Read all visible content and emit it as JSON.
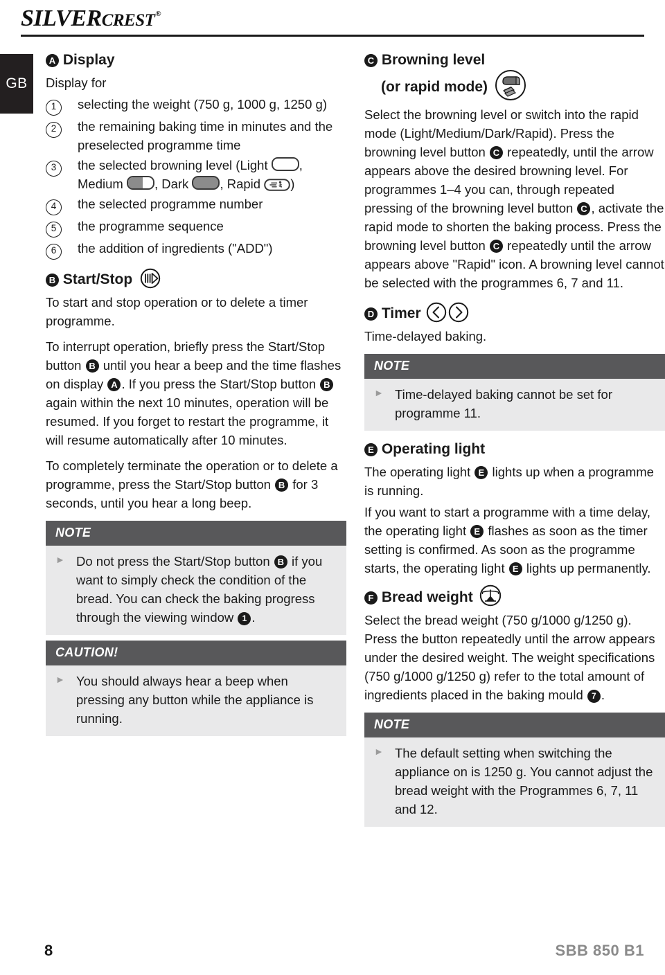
{
  "header": {
    "brand_silver": "SILVER",
    "brand_crest": "CREST",
    "brand_reg": "®"
  },
  "language_tab": {
    "label": "GB"
  },
  "left_column": {
    "section_a": {
      "marker": "A",
      "title": "Display",
      "intro": "Display for",
      "items": [
        {
          "num": "1",
          "text": "selecting the weight (750 g, 1000 g, 1250 g)"
        },
        {
          "num": "2",
          "text": "the remaining baking time in minutes and the preselected programme time"
        },
        {
          "num": "3",
          "text_before": "the selected browning level (Light ",
          "text_mid1": ", Medium ",
          "text_mid2": ", Dark ",
          "text_mid3": ", Rapid ",
          "text_after": ")"
        },
        {
          "num": "4",
          "text": "the selected programme number"
        },
        {
          "num": "5",
          "text": "the programme sequence"
        },
        {
          "num": "6",
          "text": "the addition of ingredients (\"ADD\")"
        }
      ]
    },
    "section_b": {
      "marker": "B",
      "title": "Start/Stop",
      "icon": "start-stop-icon",
      "para1": "To start and stop operation or to delete a timer programme.",
      "para2_1": "To interrupt operation, briefly press the Start/Stop button ",
      "para2_2": " until you hear a beep and the time flashes on display ",
      "para2_3": ". If you press the Start/Stop button ",
      "para2_4": " again within the next 10 minutes, operation will be resumed. If you forget to restart the programme, it will resume automatically after 10 minutes.",
      "para2_mark_b1": "B",
      "para2_mark_a": "A",
      "para2_mark_b2": "B",
      "para3_1": "To completely terminate the operation or to delete a programme, press the Start/Stop button ",
      "para3_mark": "B",
      "para3_2": " for 3 seconds, until you hear a long beep."
    },
    "note_box": {
      "head": "NOTE",
      "text_1": "Do not press the Start/Stop button ",
      "mark": "B",
      "text_2": " if you want to simply check the condition of the bread. You can check the baking progress through the viewing window ",
      "mark2": "1",
      "text_3": "."
    },
    "caution_box": {
      "head": "CAUTION!",
      "text": "You should always hear a beep when pressing any button while the appliance is running."
    }
  },
  "right_column": {
    "section_c": {
      "marker": "C",
      "title_line1": "Browning level",
      "title_line2": "(or rapid mode)",
      "icon": "bread-loaf-icon",
      "para_1": "Select the browning level or switch into the rapid mode (Light/Medium/Dark/Rapid). Press the browning level button ",
      "mark_c1": "C",
      "para_2": " repeatedly, until the arrow appears above the desired browning level. For programmes 1–4 you can, through repeated pressing of the browning level button ",
      "mark_c2": "C",
      "para_3": ", activate the rapid mode to shorten the baking process. Press the browning level button ",
      "mark_c3": "C",
      "para_4": " repeatedly until the arrow appears above \"Rapid\" icon. A browning level cannot be selected with the programmes 6, 7 and 11."
    },
    "section_d": {
      "marker": "D",
      "title": "Timer",
      "icon_left": "chevron-left-circle-icon",
      "icon_right": "chevron-right-circle-icon",
      "para": "Time-delayed baking."
    },
    "note_box_d": {
      "head": "NOTE",
      "text": "Time-delayed baking cannot be set for programme 11."
    },
    "section_e": {
      "marker": "E",
      "title": "Operating light",
      "para_1": "The operating light ",
      "mark_e1": "E",
      "para_2": " lights up when a programme is running.",
      "para_3": "If you want to start a programme with a time delay, the operating light ",
      "mark_e2": "E",
      "para_4": " flashes as soon as the timer setting is confirmed. As soon as the programme starts, the operating light ",
      "mark_e3": "E",
      "para_5": " lights up permanently."
    },
    "section_f": {
      "marker": "F",
      "title": "Bread weight",
      "icon": "scales-icon",
      "para_1": "Select the bread weight (750 g/1000 g/1250 g). Press the button repeatedly until the arrow appears under the desired weight. The weight specifications (750 g/1000 g/1250 g) refer to the total amount of ingredients placed in the baking mould ",
      "mark_7": "7",
      "para_2": "."
    },
    "note_box_f": {
      "head": "NOTE",
      "text": "The default setting when switching the appliance on is 1250 g. You cannot adjust the bread weight with the Programmes 6, 7, 11 and 12."
    }
  },
  "footer": {
    "page_number": "8",
    "model": "SBB 850 B1"
  },
  "colors": {
    "callout_header_bg": "#58585a",
    "callout_body_bg": "#e9e9ea",
    "lang_tab_bg": "#231f20",
    "footer_model": "#8a8a8a"
  }
}
